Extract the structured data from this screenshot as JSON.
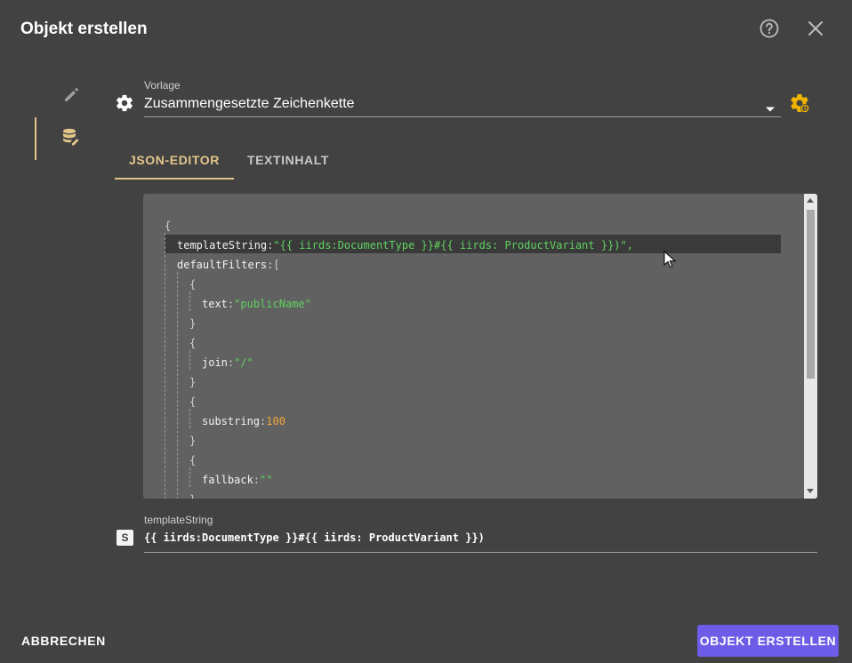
{
  "dialog": {
    "title": "Objekt erstellen",
    "help_icon": "help-circle-icon",
    "close_icon": "close-icon"
  },
  "sidebar": {
    "items": [
      {
        "icon": "pencil-icon",
        "active": false
      },
      {
        "icon": "database-edit-icon",
        "active": true
      }
    ]
  },
  "vorlage": {
    "label": "Vorlage",
    "value": "Zusammengesetzte Zeichenkette",
    "left_icon": "gear-icon",
    "dropdown_icon": "caret-down-icon",
    "settings_icon": "gear-settings-icon"
  },
  "tabs": [
    {
      "label": "JSON-EDITOR",
      "active": true
    },
    {
      "label": "TEXTINHALT",
      "active": false
    }
  ],
  "editor": {
    "lines": {
      "l1": "{",
      "l2_key": "templateString",
      "l2_colon": ":",
      "l2_value": "\"{{ iirds:DocumentType }}#{{ iirds: ProductVariant }})\"",
      "l2_comma": ",",
      "l3_key": "defaultFilters",
      "l3_rest": ":[",
      "l4": "{",
      "l5_key": "text",
      "l5_colon": ":",
      "l5_value": "\"publicName\"",
      "l6": "}",
      "l7": "{",
      "l8_key": "join",
      "l8_colon": ":",
      "l8_value": "\"/\"",
      "l9": "}",
      "l10": "{",
      "l11_key": "substring",
      "l11_colon": ":",
      "l11_value": "100",
      "l12": "}",
      "l13": "{",
      "l14_key": "fallback",
      "l14_colon": ":",
      "l14_value": "\"\"",
      "l15": "}"
    }
  },
  "template_string_field": {
    "label": "templateString",
    "type_badge": "S",
    "value": "{{ iirds:DocumentType }}#{{ iirds: ProductVariant }})"
  },
  "actions": {
    "cancel": "ABBRECHEN",
    "create": "OBJEKT ERSTELLEN"
  },
  "colors": {
    "accent": "#e3c58a",
    "primary_button": "#6c5ce7",
    "string": "#5fd35f",
    "number": "#f0a63a",
    "settings_icon": "#f0b400"
  }
}
